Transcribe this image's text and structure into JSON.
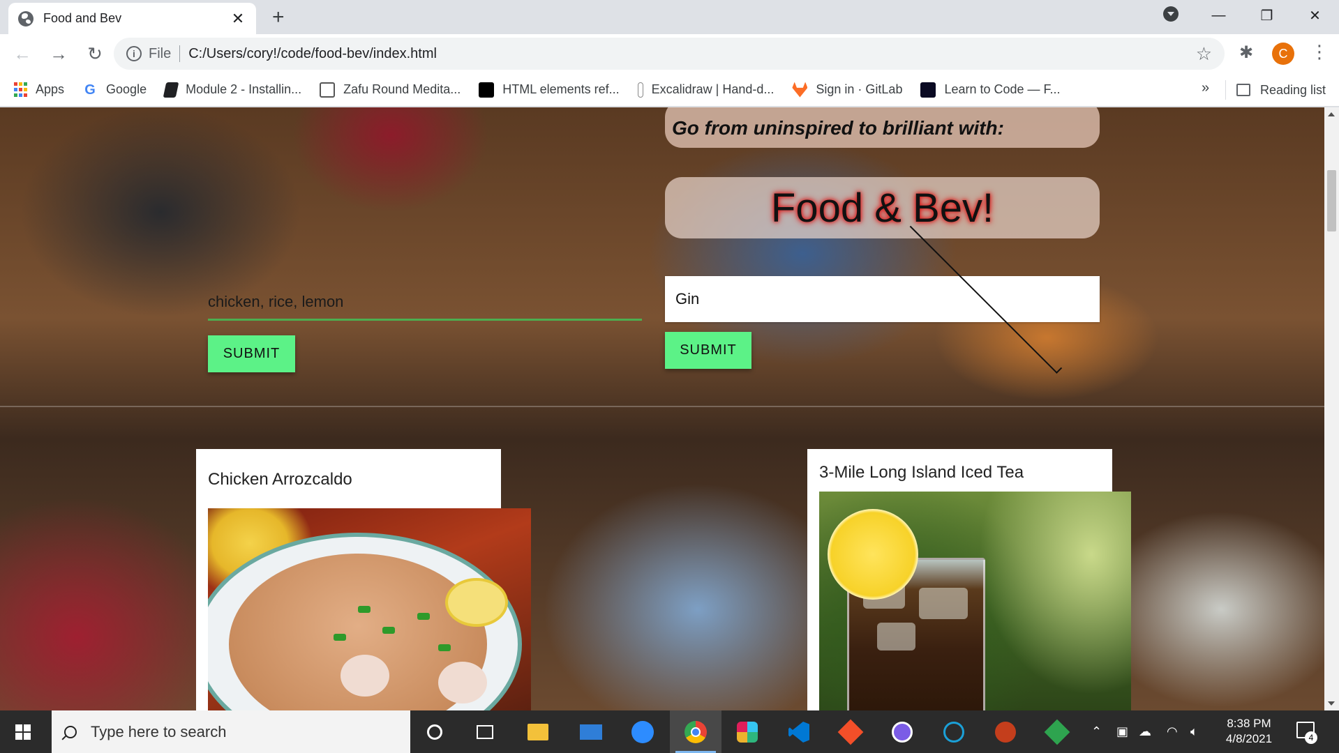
{
  "browser": {
    "tab_title": "Food and Bev",
    "tab_close": "✕",
    "new_tab": "+",
    "url_scheme": "File",
    "url": "C:/Users/cory!/code/food-bev/index.html",
    "profile_initial": "C",
    "window_controls": [
      "—",
      "❐",
      "✕"
    ]
  },
  "bookmarks": {
    "items": [
      {
        "label": "Apps",
        "icon": "apps-grid-icon"
      },
      {
        "label": "Google",
        "icon": "google-icon"
      },
      {
        "label": "Module 2 - Installin...",
        "icon": "module-icon"
      },
      {
        "label": "Zafu Round Medita...",
        "icon": "zafu-icon"
      },
      {
        "label": "HTML elements ref...",
        "icon": "mdn-icon"
      },
      {
        "label": "Excalidraw | Hand-d...",
        "icon": "excalidraw-icon"
      },
      {
        "label": "Sign in · GitLab",
        "icon": "gitlab-icon"
      },
      {
        "label": "Learn to Code — F...",
        "icon": "freecodecamp-icon"
      }
    ],
    "more": "»",
    "reading_list": "Reading list"
  },
  "page": {
    "tagline": "Go from uninspired to brilliant with:",
    "brand": "Food & Bev!",
    "food_input_value": "chicken, rice, lemon",
    "food_submit": "SUBMIT",
    "drink_select_value": "Gin",
    "drink_submit": "SUBMIT",
    "food_card_title": "Chicken Arrozcaldo",
    "drink_card_title": "3-Mile Long Island Iced Tea"
  },
  "taskbar": {
    "search_placeholder": "Type here to search",
    "time": "8:38 PM",
    "date": "4/8/2021",
    "notification_count": "4",
    "pinned": [
      "cortana-icon",
      "task-view-icon",
      "file-explorer-icon",
      "mail-icon",
      "zoom-icon",
      "chrome-icon",
      "slack-icon",
      "vscode-icon",
      "git-kraken-icon",
      "obs-icon",
      "cisco-icon",
      "powerpoint-icon",
      "git-icon"
    ]
  },
  "colors": {
    "submit_button": "#5cf287",
    "input_underline": "#4caf50",
    "brand_glow": "#e01010",
    "profile_avatar": "#e8710a"
  }
}
